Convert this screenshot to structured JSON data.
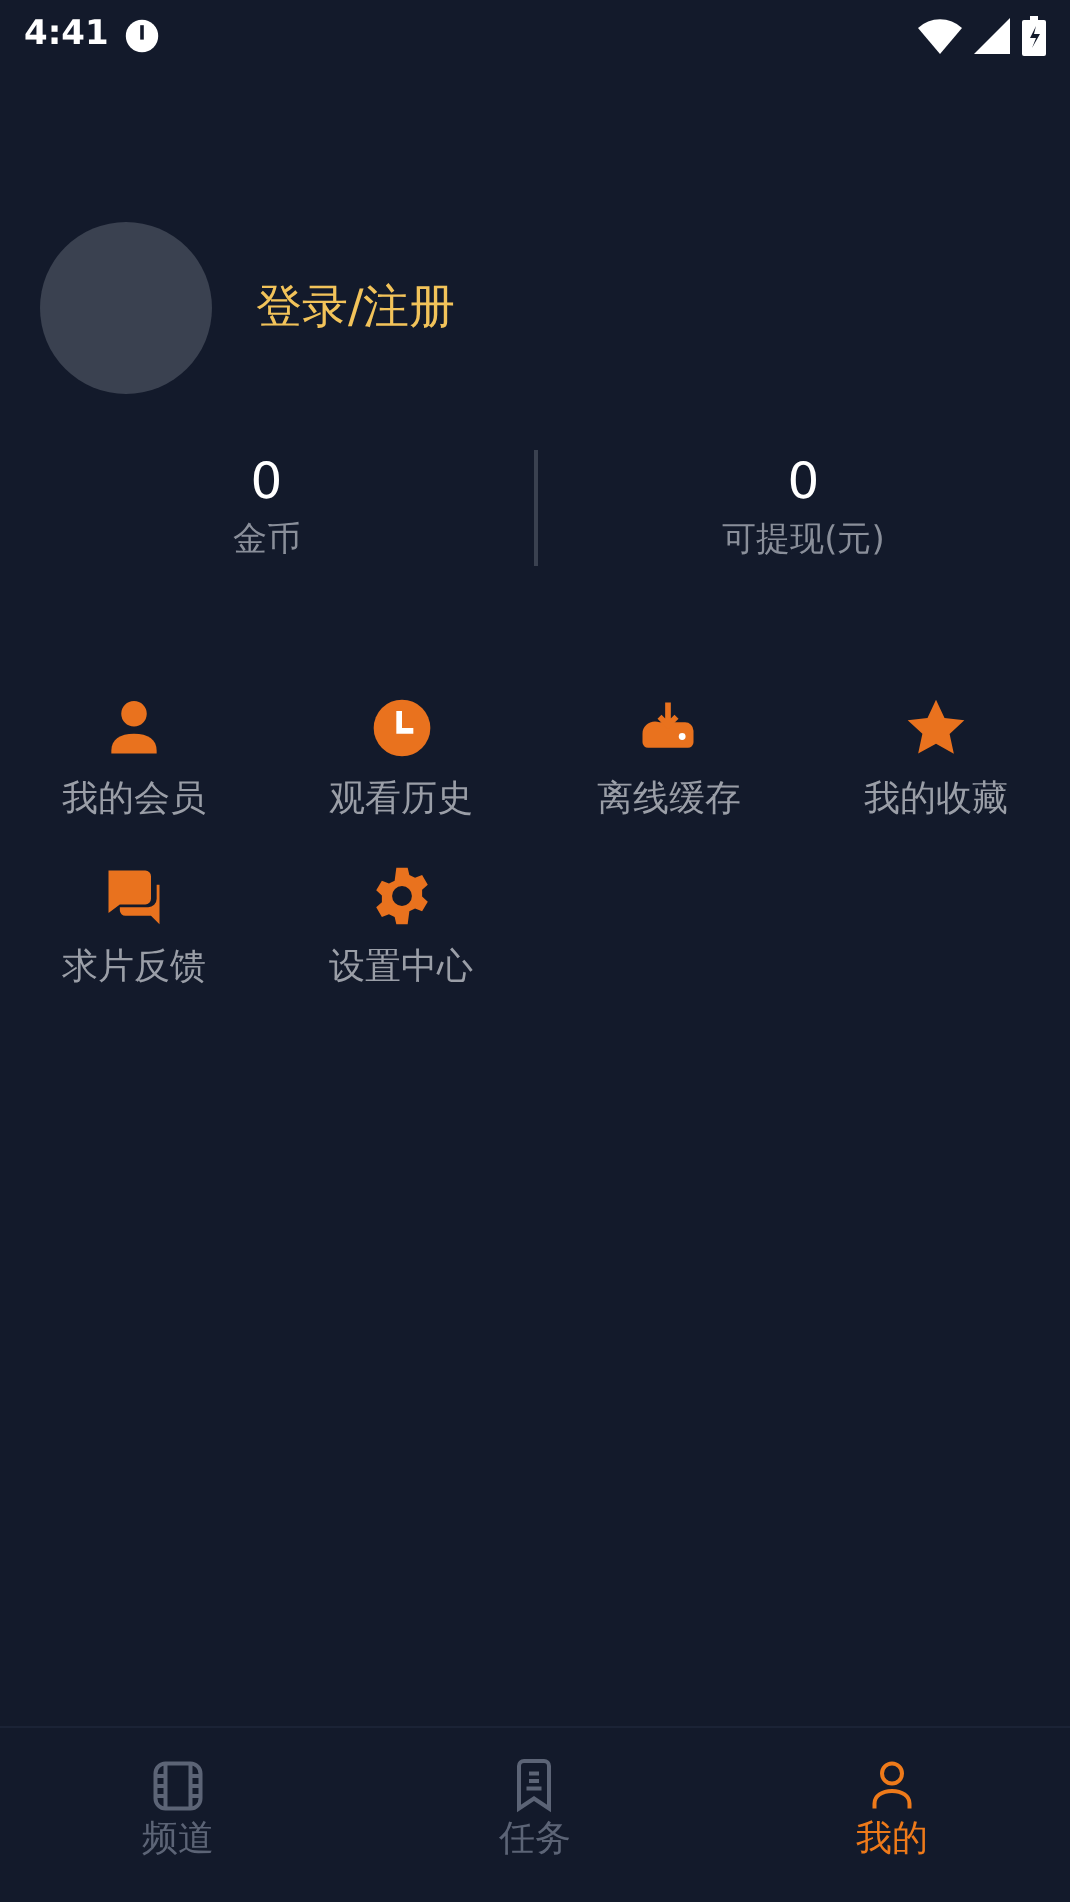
{
  "status_bar": {
    "time": "4:41"
  },
  "profile": {
    "login_label": "登录/注册"
  },
  "stats": [
    {
      "value": "0",
      "label": "金币"
    },
    {
      "value": "0",
      "label": "可提现(元)"
    }
  ],
  "menu": [
    {
      "kind": "member",
      "label": "我的会员"
    },
    {
      "kind": "history",
      "label": "观看历史"
    },
    {
      "kind": "download",
      "label": "离线缓存"
    },
    {
      "kind": "favorite",
      "label": "我的收藏"
    },
    {
      "kind": "feedback",
      "label": "求片反馈"
    },
    {
      "kind": "settings",
      "label": "设置中心"
    }
  ],
  "tabs": [
    {
      "kind": "film",
      "label": "频道",
      "selected": false
    },
    {
      "kind": "task",
      "label": "任务",
      "selected": false
    },
    {
      "kind": "user",
      "label": "我的",
      "selected": true
    }
  ]
}
